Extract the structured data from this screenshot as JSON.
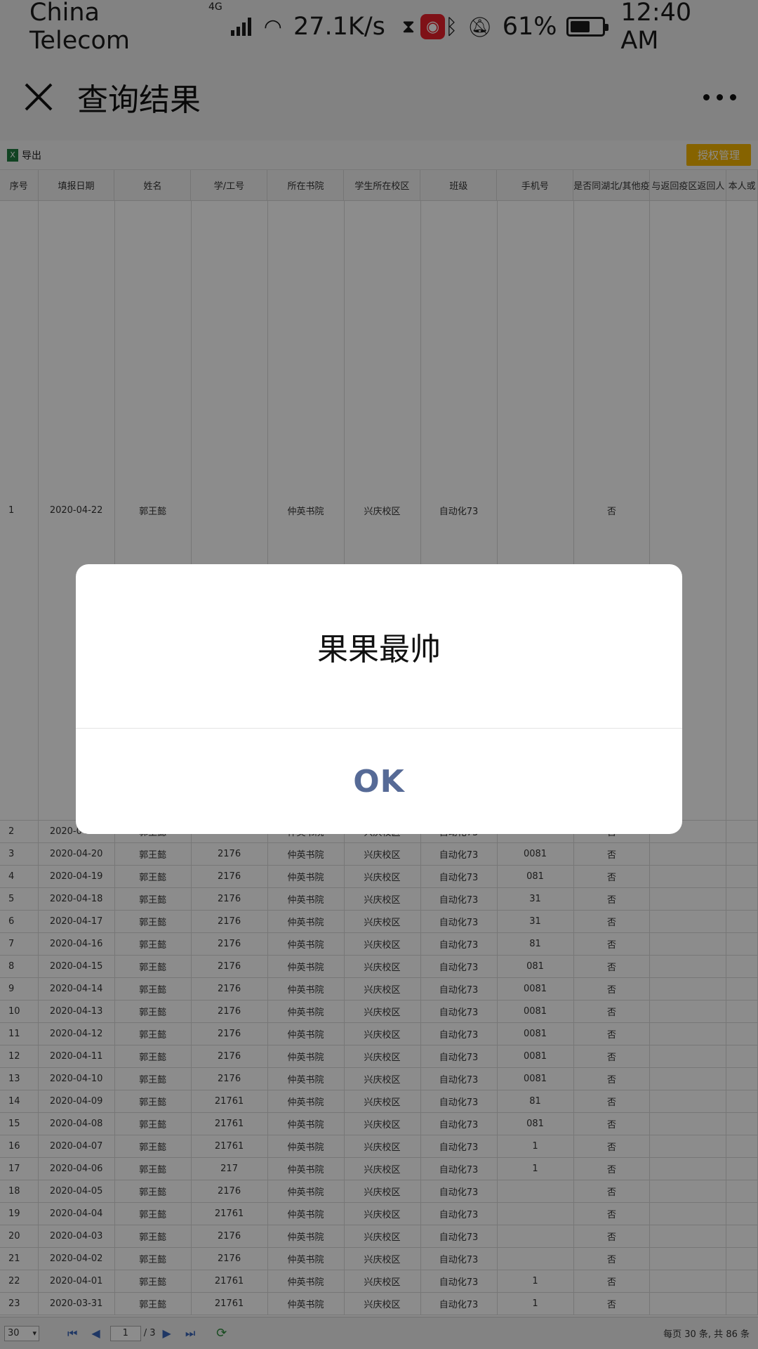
{
  "status_bar": {
    "carrier": "China Telecom",
    "network": "4G",
    "speed": "27.1K/s",
    "battery": "61%",
    "battery_level": 0.61,
    "time": "12:40 AM"
  },
  "title_bar": {
    "title": "查询结果"
  },
  "toolbar": {
    "export_label": "导出",
    "auth_label": "授权管理"
  },
  "table": {
    "headers": [
      "序号",
      "填报日期",
      "姓名",
      "学/工号",
      "所在书院",
      "学生所在校区",
      "班级",
      "手机号",
      "是否同湖北/其他疫",
      "与返回疫区返回人",
      "本人或"
    ],
    "rows": [
      {
        "idx": "1",
        "date": "2020-04-22",
        "name": "郭王懿",
        "sid": "",
        "college": "仲英书院",
        "campus": "兴庆校区",
        "cls": "自动化73",
        "phone": "",
        "hubei": "否"
      },
      {
        "idx": "2",
        "date": "2020-04-21",
        "name": "郭王懿",
        "sid": "217",
        "college": "仲英书院",
        "campus": "兴庆校区",
        "cls": "自动化73",
        "phone": "6008...",
        "hubei": "否"
      },
      {
        "idx": "3",
        "date": "2020-04-20",
        "name": "郭王懿",
        "sid": "2176",
        "college": "仲英书院",
        "campus": "兴庆校区",
        "cls": "自动化73",
        "phone": "0081",
        "hubei": "否"
      },
      {
        "idx": "4",
        "date": "2020-04-19",
        "name": "郭王懿",
        "sid": "2176",
        "college": "仲英书院",
        "campus": "兴庆校区",
        "cls": "自动化73",
        "phone": "081",
        "hubei": "否"
      },
      {
        "idx": "5",
        "date": "2020-04-18",
        "name": "郭王懿",
        "sid": "2176",
        "college": "仲英书院",
        "campus": "兴庆校区",
        "cls": "自动化73",
        "phone": "31",
        "hubei": "否"
      },
      {
        "idx": "6",
        "date": "2020-04-17",
        "name": "郭王懿",
        "sid": "2176",
        "college": "仲英书院",
        "campus": "兴庆校区",
        "cls": "自动化73",
        "phone": "31",
        "hubei": "否"
      },
      {
        "idx": "7",
        "date": "2020-04-16",
        "name": "郭王懿",
        "sid": "2176",
        "college": "仲英书院",
        "campus": "兴庆校区",
        "cls": "自动化73",
        "phone": "81",
        "hubei": "否"
      },
      {
        "idx": "8",
        "date": "2020-04-15",
        "name": "郭王懿",
        "sid": "2176",
        "college": "仲英书院",
        "campus": "兴庆校区",
        "cls": "自动化73",
        "phone": "081",
        "hubei": "否"
      },
      {
        "idx": "9",
        "date": "2020-04-14",
        "name": "郭王懿",
        "sid": "2176",
        "college": "仲英书院",
        "campus": "兴庆校区",
        "cls": "自动化73",
        "phone": "0081",
        "hubei": "否"
      },
      {
        "idx": "10",
        "date": "2020-04-13",
        "name": "郭王懿",
        "sid": "2176",
        "college": "仲英书院",
        "campus": "兴庆校区",
        "cls": "自动化73",
        "phone": "0081",
        "hubei": "否"
      },
      {
        "idx": "11",
        "date": "2020-04-12",
        "name": "郭王懿",
        "sid": "2176",
        "college": "仲英书院",
        "campus": "兴庆校区",
        "cls": "自动化73",
        "phone": "0081",
        "hubei": "否"
      },
      {
        "idx": "12",
        "date": "2020-04-11",
        "name": "郭王懿",
        "sid": "2176",
        "college": "仲英书院",
        "campus": "兴庆校区",
        "cls": "自动化73",
        "phone": "0081",
        "hubei": "否"
      },
      {
        "idx": "13",
        "date": "2020-04-10",
        "name": "郭王懿",
        "sid": "2176",
        "college": "仲英书院",
        "campus": "兴庆校区",
        "cls": "自动化73",
        "phone": "0081",
        "hubei": "否"
      },
      {
        "idx": "14",
        "date": "2020-04-09",
        "name": "郭王懿",
        "sid": "21761",
        "college": "仲英书院",
        "campus": "兴庆校区",
        "cls": "自动化73",
        "phone": "81",
        "hubei": "否"
      },
      {
        "idx": "15",
        "date": "2020-04-08",
        "name": "郭王懿",
        "sid": "21761",
        "college": "仲英书院",
        "campus": "兴庆校区",
        "cls": "自动化73",
        "phone": "081",
        "hubei": "否"
      },
      {
        "idx": "16",
        "date": "2020-04-07",
        "name": "郭王懿",
        "sid": "21761",
        "college": "仲英书院",
        "campus": "兴庆校区",
        "cls": "自动化73",
        "phone": "1",
        "hubei": "否"
      },
      {
        "idx": "17",
        "date": "2020-04-06",
        "name": "郭王懿",
        "sid": "217",
        "college": "仲英书院",
        "campus": "兴庆校区",
        "cls": "自动化73",
        "phone": "1",
        "hubei": "否"
      },
      {
        "idx": "18",
        "date": "2020-04-05",
        "name": "郭王懿",
        "sid": "2176",
        "college": "仲英书院",
        "campus": "兴庆校区",
        "cls": "自动化73",
        "phone": "",
        "hubei": "否"
      },
      {
        "idx": "19",
        "date": "2020-04-04",
        "name": "郭王懿",
        "sid": "21761",
        "college": "仲英书院",
        "campus": "兴庆校区",
        "cls": "自动化73",
        "phone": "",
        "hubei": "否"
      },
      {
        "idx": "20",
        "date": "2020-04-03",
        "name": "郭王懿",
        "sid": "2176",
        "college": "仲英书院",
        "campus": "兴庆校区",
        "cls": "自动化73",
        "phone": "",
        "hubei": "否"
      },
      {
        "idx": "21",
        "date": "2020-04-02",
        "name": "郭王懿",
        "sid": "2176",
        "college": "仲英书院",
        "campus": "兴庆校区",
        "cls": "自动化73",
        "phone": "",
        "hubei": "否"
      },
      {
        "idx": "22",
        "date": "2020-04-01",
        "name": "郭王懿",
        "sid": "21761",
        "college": "仲英书院",
        "campus": "兴庆校区",
        "cls": "自动化73",
        "phone": "1",
        "hubei": "否"
      },
      {
        "idx": "23",
        "date": "2020-03-31",
        "name": "郭王懿",
        "sid": "21761",
        "college": "仲英书院",
        "campus": "兴庆校区",
        "cls": "自动化73",
        "phone": "1",
        "hubei": "否"
      }
    ]
  },
  "pager": {
    "page_size": "30",
    "current_page": "1",
    "total_pages": "/ 3",
    "summary": "每页 30 条, 共 86 条"
  },
  "dialog": {
    "message": "果果最帅",
    "ok_label": "OK",
    "ok_color": "#566a96"
  }
}
